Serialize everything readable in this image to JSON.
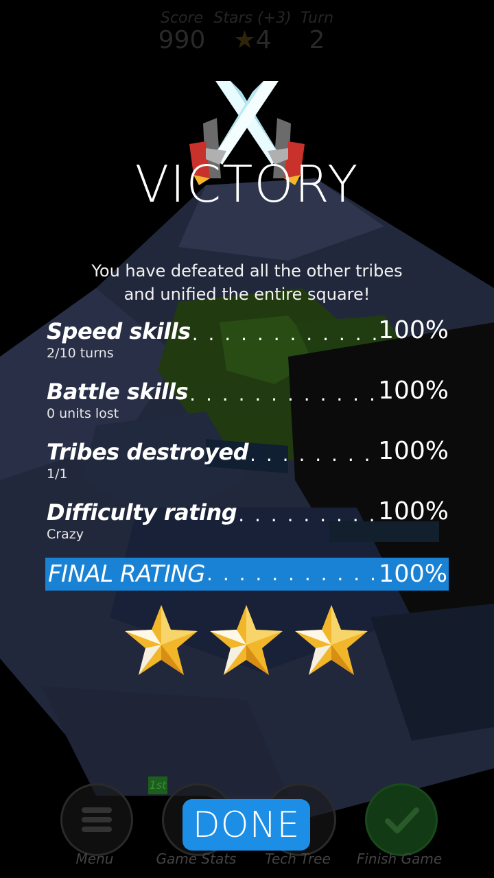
{
  "hud": {
    "score_label": "Score",
    "score_value": "990",
    "stars_label": "Stars (+3)",
    "stars_value": "4",
    "star_glyph": "★",
    "turn_label": "Turn",
    "turn_value": "2"
  },
  "title": "VICTORY",
  "subtitle": "You have defeated all the other tribes\nand unified the entire square!",
  "ratings": [
    {
      "label": "Speed skills",
      "value": "100%",
      "detail": "2/10 turns"
    },
    {
      "label": "Battle skills",
      "value": "100%",
      "detail": "0 units lost"
    },
    {
      "label": "Tribes destroyed",
      "value": "100%",
      "detail": "1/1"
    },
    {
      "label": "Difficulty rating",
      "value": "100%",
      "detail": "Crazy"
    }
  ],
  "final": {
    "label": "FINAL RATING",
    "value": "100%"
  },
  "stars_earned": 3,
  "bottom_nav": {
    "rank": "1st",
    "menu": "Menu",
    "game_stats": "Game Stats",
    "tech_tree": "Tech Tree",
    "finish_game": "Finish Game"
  },
  "done_button": "DONE",
  "colors": {
    "accent_blue": "#1a82d4",
    "star_gold": "#f2b62a"
  }
}
